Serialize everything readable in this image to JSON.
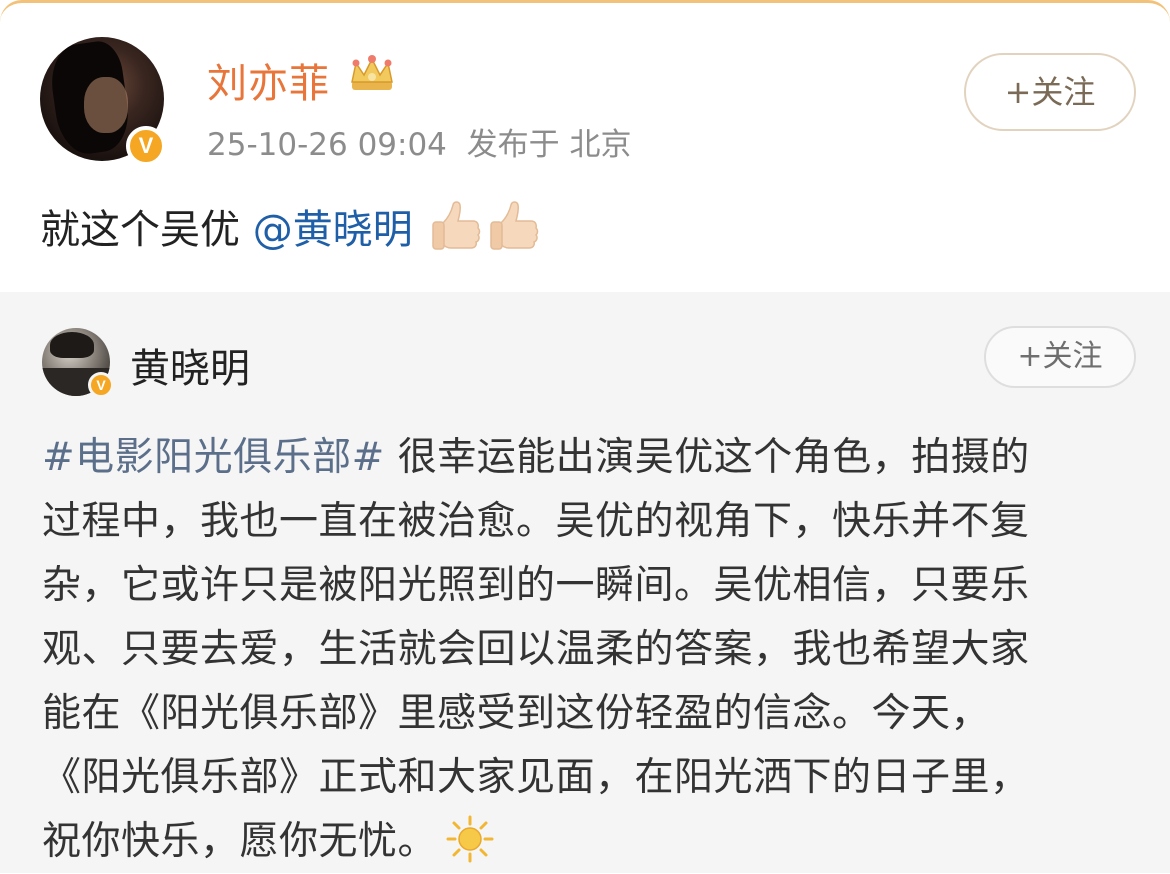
{
  "post": {
    "author": "刘亦菲",
    "verified_badge": "V",
    "timestamp": "25-10-26 09:04",
    "location": "发布于 北京",
    "follow_label": "+关注",
    "text_prefix": "就这个吴优 ",
    "mention": "@黄晓明",
    "emojis": [
      "thumbs-up-icon",
      "thumbs-up-icon"
    ]
  },
  "repost": {
    "author": "黄晓明",
    "verified_badge": "V",
    "follow_label": "+关注",
    "hashtag": "#电影阳光俱乐部#",
    "lines": [
      " 很幸运能出演吴优这个角色，拍摄的",
      "过程中，我也一直在被治愈。吴优的视角下，快乐并不复",
      "杂，它或许只是被阳光照到的一瞬间。吴优相信，只要乐",
      "观、只要去爱，生活就会回以温柔的答案，我也希望大家",
      "能在《阳光俱乐部》里感受到这份轻盈的信念。今天，",
      "《阳光俱乐部》正式和大家见面，在阳光洒下的日子里，",
      "祝你快乐，愿你无忧。"
    ],
    "end_emoji": "sun-icon"
  },
  "colors": {
    "author_name": "#e8753a",
    "mention": "#1f5fa8",
    "hashtag": "#5c6f8a",
    "verified": "#f5a623",
    "quote_bg": "#f5f5f5"
  }
}
